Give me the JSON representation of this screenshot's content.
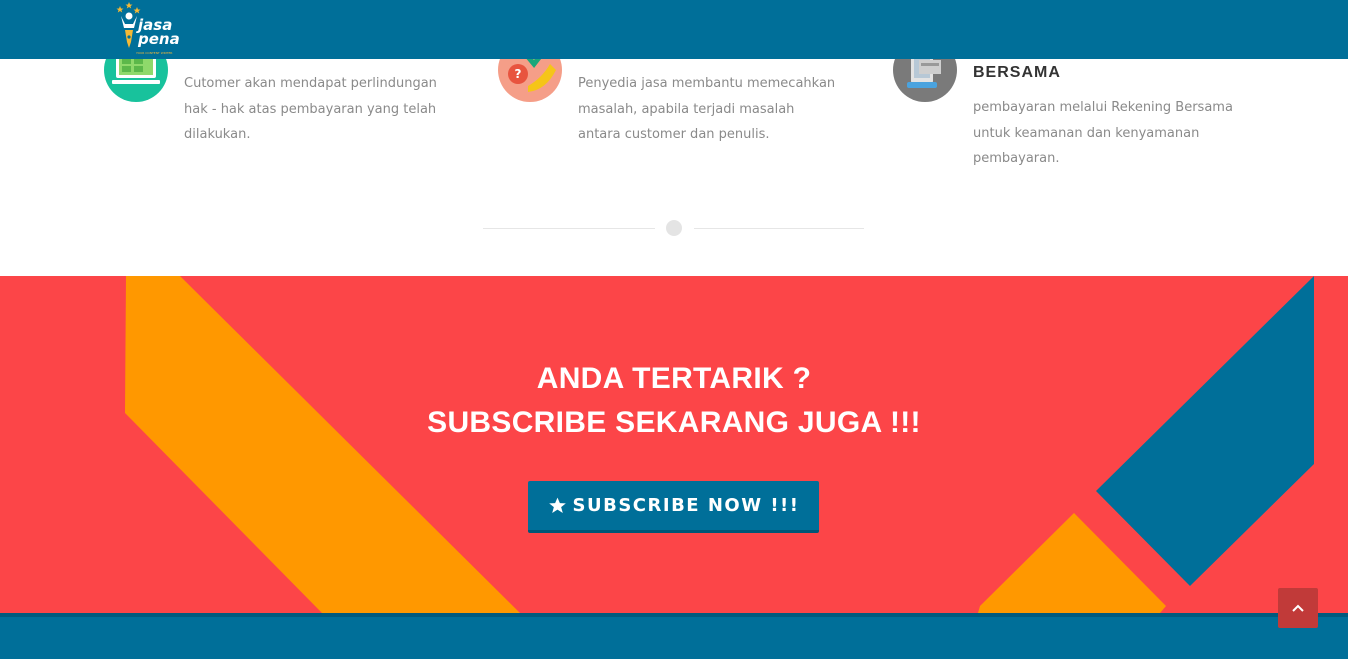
{
  "brand": {
    "logo_line1": "jasa",
    "logo_line2": "pena",
    "logo_tagline": "YOUR CONTENT WRITER"
  },
  "features": [
    {
      "icon": "money-transfer-icon",
      "title": "",
      "text": "Cutomer akan mendapat perlindungan hak - hak atas pembayaran yang telah dilakukan."
    },
    {
      "icon": "support-chat-icon",
      "title": "",
      "text": "Penyedia jasa membantu memecahkan masalah, apabila terjadi masalah antara customer dan penulis."
    },
    {
      "icon": "mobile-payment-icon",
      "title": "BERSAMA",
      "text": "pembayaran melalui Rekening Bersama untuk keamanan dan kenyamanan pembayaran."
    }
  ],
  "cta": {
    "heading_line1": "ANDA TERTARIK ?",
    "heading_line2": "SUBSCRIBE SEKARANG JUGA !!!",
    "button_label": "SUBSCRIBE NOW !!!",
    "button_icon": "star-icon"
  },
  "back_to_top": {
    "icon": "chevron-up-icon"
  },
  "colors": {
    "header": "#006f99",
    "cta_background": "#fc4548",
    "cta_orange": "#ff9800",
    "cta_blue": "#006f99",
    "button": "#006f99",
    "back_to_top": "#c13a39"
  }
}
